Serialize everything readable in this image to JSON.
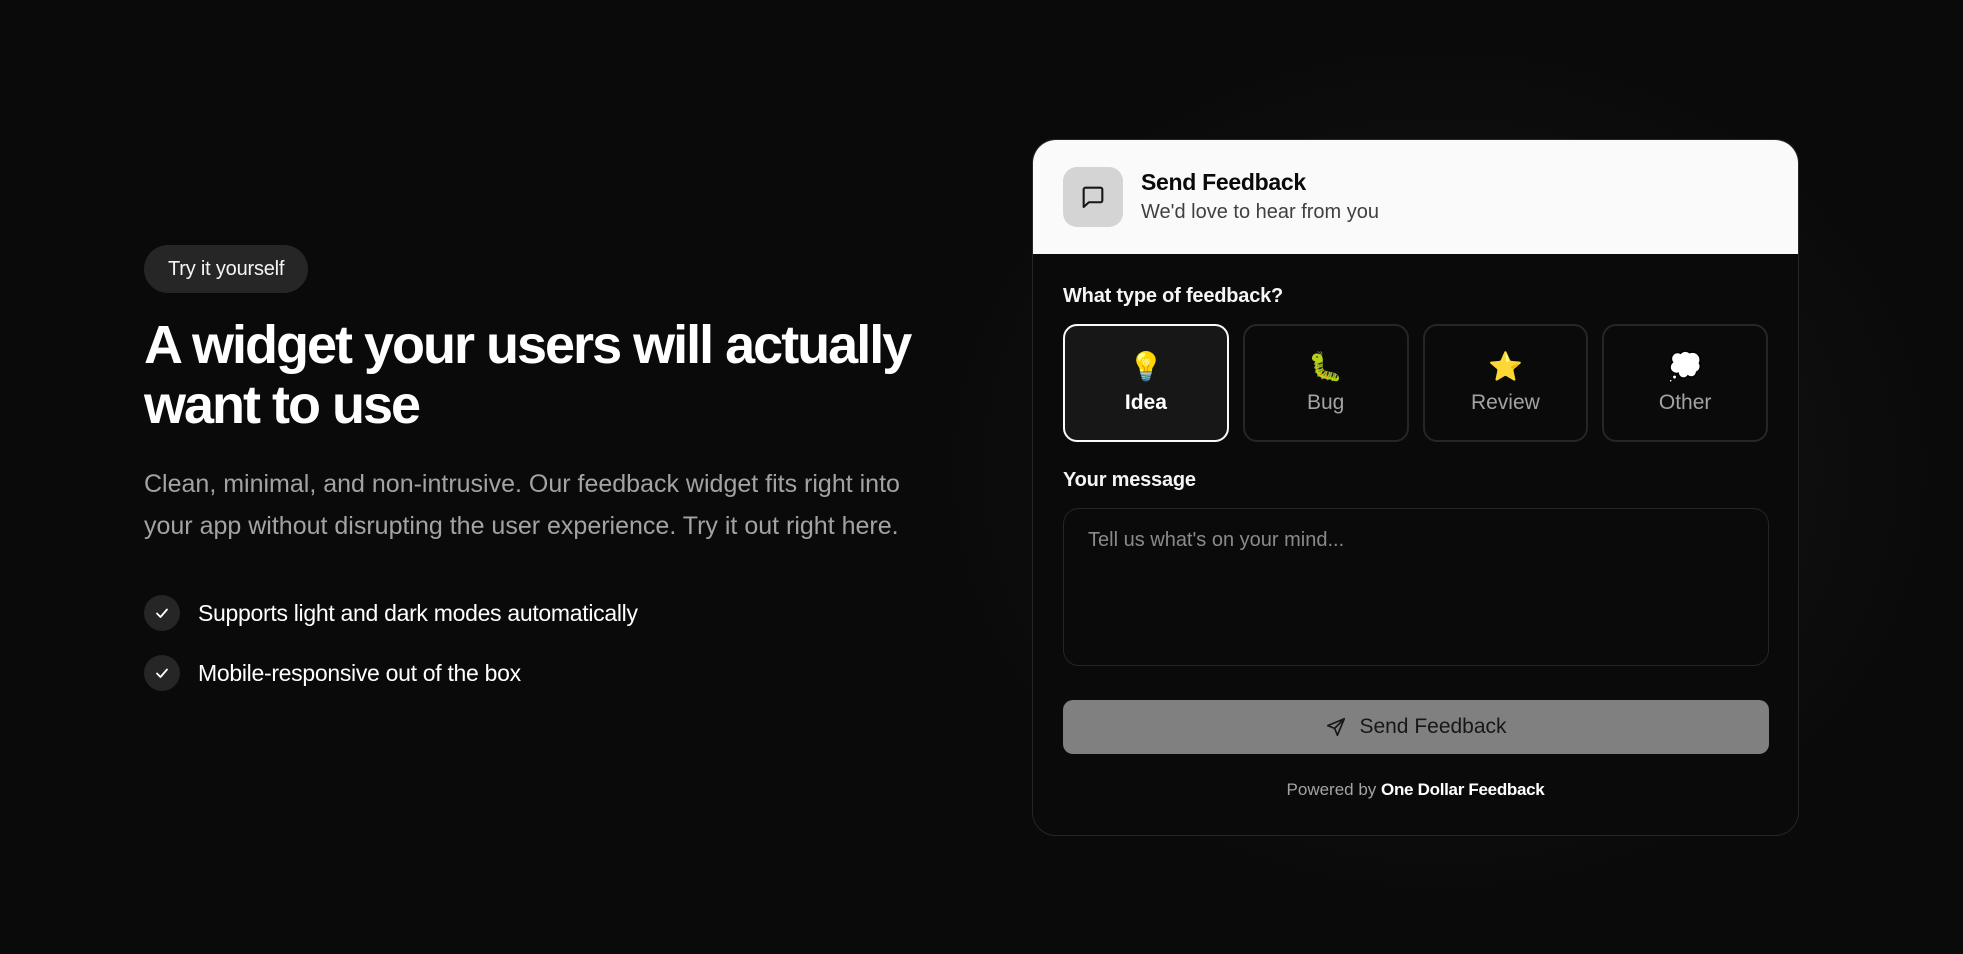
{
  "hero": {
    "badge": "Try it yourself",
    "headline": "A widget your users will actually want to use",
    "lead": "Clean, minimal, and non-intrusive. Our feedback widget fits right into your app without disrupting the user experience. Try it out right here.",
    "features": [
      {
        "text": "Supports light and dark modes automatically",
        "icon": "check-icon"
      },
      {
        "text": "Mobile-responsive out of the box",
        "icon": "check-icon"
      }
    ]
  },
  "widget": {
    "header": {
      "icon": "message-square-icon",
      "title": "Send Feedback",
      "subtitle": "We'd love to hear from you"
    },
    "type_label": "What type of feedback?",
    "types": [
      {
        "emoji": "💡",
        "label": "Idea",
        "selected": true,
        "icon": "lightbulb-icon"
      },
      {
        "emoji": "🐛",
        "label": "Bug",
        "selected": false,
        "icon": "bug-icon"
      },
      {
        "emoji": "⭐",
        "label": "Review",
        "selected": false,
        "icon": "star-icon"
      },
      {
        "emoji": "💭",
        "label": "Other",
        "selected": false,
        "icon": "thought-bubble-icon"
      }
    ],
    "message_label": "Your message",
    "message_placeholder": "Tell us what's on your mind...",
    "message_value": "",
    "submit": {
      "icon": "send-icon",
      "label": "Send Feedback"
    },
    "powered_by": {
      "prefix": "Powered by",
      "brand": "One Dollar Feedback"
    }
  },
  "colors": {
    "page_background": "#0a0a0a",
    "card_header_background": "#fafafa",
    "submit_disabled": "#808080",
    "muted_text": "#a3a3a3"
  }
}
